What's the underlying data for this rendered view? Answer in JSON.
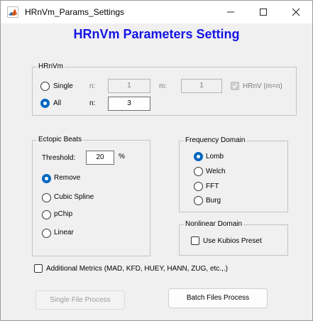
{
  "window": {
    "title": "HRnVm_Params_Settings"
  },
  "heading": "HRnVm Parameters Setting",
  "hrnvm_panel": {
    "title": "HRnVm",
    "single_label": "Single",
    "all_label": "All",
    "n_label_1": "n:",
    "n_value_1": "1",
    "m_label": "m:",
    "m_value": "1",
    "hrnv_label": "HRnV (m=n)",
    "n_label_2": "n:",
    "n_value_2": "3",
    "selected": "All"
  },
  "ectopic_panel": {
    "title": "Ectopic Beats",
    "threshold_label": "Threshold:",
    "threshold_value": "20",
    "percent_label": "%",
    "options": [
      "Remove",
      "Cubic Spline",
      "pChip",
      "Linear"
    ],
    "selected": "Remove"
  },
  "frequency_panel": {
    "title": "Frequency Domain",
    "options": [
      "Lomb",
      "Welch",
      "FFT",
      "Burg"
    ],
    "selected": "Lomb"
  },
  "nonlinear_panel": {
    "title": "Nonlinear Domain",
    "kubios_label": "Use Kubios Preset",
    "kubios_checked": false
  },
  "additional_metrics_label": "Additional Metrics (MAD, KFD, HUEY, HANN, ZUG, etc.,.)",
  "additional_metrics_checked": false,
  "buttons": {
    "single_file": "Single File Process",
    "batch_files": "Batch Files Process"
  },
  "colors": {
    "heading": "#1414e6",
    "accent": "#0067c0"
  }
}
